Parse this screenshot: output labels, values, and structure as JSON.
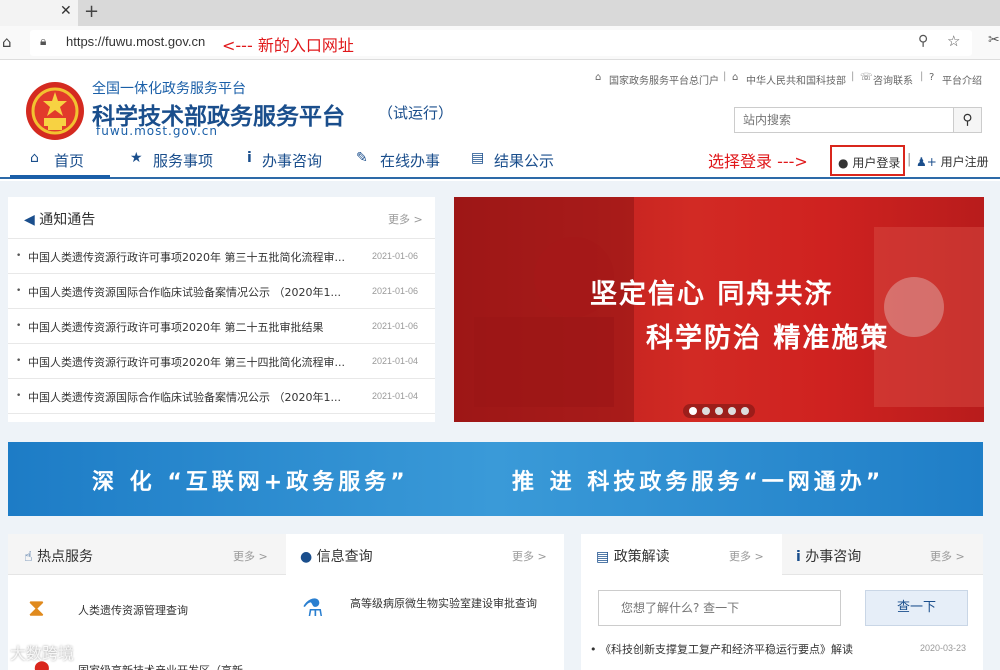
{
  "browser": {
    "tab_close": "✕",
    "new_tab": "+",
    "url": "https://fuwu.most.gov.cn",
    "url_annotation": "<--- 新的入口网址"
  },
  "header": {
    "subtitle": "全国一体化政务服务平台",
    "title": "科学技术部政务服务平台",
    "title_trial": "（试运行）",
    "domain": "fuwu.most.gov.cn",
    "top_links": [
      "国家政务服务平台总门户",
      "中华人民共和国科技部",
      "咨询联系",
      "平台介绍"
    ],
    "search_placeholder": "站内搜索",
    "nav": [
      "首页",
      "服务事项",
      "办事咨询",
      "在线办事",
      "结果公示"
    ],
    "login_annotation": "选择登录 --->",
    "login_label": "用户登录",
    "register_label": "用户注册"
  },
  "notices": {
    "title": "通知通告",
    "more": "更多 >",
    "items": [
      {
        "text": "中国人类遗传资源行政许可事项2020年 第三十五批简化流程审...",
        "date": "2021-01-06"
      },
      {
        "text": "中国人类遗传资源国际合作临床试验备案情况公示 （2020年1...",
        "date": "2021-01-06"
      },
      {
        "text": "中国人类遗传资源行政许可事项2020年 第二十五批审批结果",
        "date": "2021-01-06"
      },
      {
        "text": "中国人类遗传资源行政许可事项2020年 第三十四批简化流程审...",
        "date": "2021-01-04"
      },
      {
        "text": "中国人类遗传资源国际合作临床试验备案情况公示 （2020年1...",
        "date": "2021-01-04"
      }
    ]
  },
  "banner": {
    "line1": "坚定信心 同舟共济",
    "line2": "科学防治 精准施策",
    "slide_count": 5,
    "active_slide": 1
  },
  "gov_banner": {
    "left": "深 化 “互联网+政务服务”",
    "right": "推 进 科技政务服务“一网通办”"
  },
  "hot_services": {
    "title": "热点服务",
    "more": "更多 >",
    "items": [
      "人类遗传资源管理查询",
      "国家级高新技术产业开发区（高新..."
    ]
  },
  "info_query": {
    "title": "信息查询",
    "more": "更多 >",
    "items": [
      "高等级病原微生物实验室建设审批查询"
    ]
  },
  "policy": {
    "title": "政策解读",
    "more": "更多 >",
    "question_placeholder": "您想了解什么? 查一下",
    "query_button": "查一下",
    "items": [
      {
        "text": "《科技创新支撑复工复产和经济平稳运行要点》解读",
        "date": "2020-03-23"
      }
    ]
  },
  "consult": {
    "title": "办事咨询",
    "more": "更多 >"
  },
  "watermark": "大数跨境",
  "colors": {
    "brand_blue": "#1a4e8c",
    "annotation_red": "#e0181b",
    "banner_red": "#c82220"
  }
}
